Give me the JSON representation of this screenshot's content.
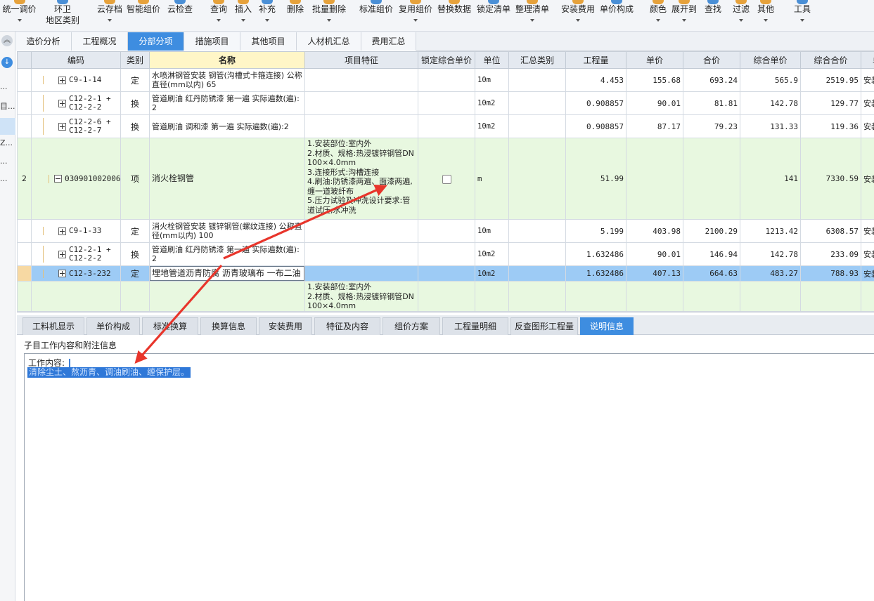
{
  "toolbar": {
    "buttons": [
      {
        "label": "统一调价",
        "dropdown": true
      },
      {
        "label": "环卫",
        "label2": "地区类别",
        "dropdown": false
      },
      {
        "label": "云存档",
        "dropdown": true
      },
      {
        "label": "智能组价",
        "dropdown": false
      },
      {
        "label": "云检查",
        "dropdown": false
      },
      {
        "label": "查询",
        "dropdown": true
      },
      {
        "label": "插入",
        "dropdown": true
      },
      {
        "label": "补充",
        "dropdown": true
      },
      {
        "label": "删除",
        "dropdown": false
      },
      {
        "label": "批量删除",
        "dropdown": true
      },
      {
        "label": "标准组价",
        "dropdown": false
      },
      {
        "label": "复用组价",
        "dropdown": true
      },
      {
        "label": "替换数据",
        "dropdown": false
      },
      {
        "label": "锁定清单",
        "dropdown": false
      },
      {
        "label": "整理清单",
        "dropdown": true
      },
      {
        "label": "安装费用",
        "dropdown": true
      },
      {
        "label": "单价构成",
        "dropdown": false
      },
      {
        "label": "颜色",
        "dropdown": true
      },
      {
        "label": "展开到",
        "dropdown": true
      },
      {
        "label": "查找",
        "dropdown": false
      },
      {
        "label": "过滤",
        "dropdown": true
      },
      {
        "label": "其他",
        "dropdown": true
      },
      {
        "label": "工具",
        "dropdown": true
      }
    ]
  },
  "left_strip": {
    "fragments": [
      "...",
      "目...",
      "Z...",
      "...",
      "..."
    ]
  },
  "tabs": [
    {
      "label": "造价分析",
      "active": false
    },
    {
      "label": "工程概况",
      "active": false
    },
    {
      "label": "分部分项",
      "active": true
    },
    {
      "label": "措施项目",
      "active": false
    },
    {
      "label": "其他项目",
      "active": false
    },
    {
      "label": "人材机汇总",
      "active": false
    },
    {
      "label": "费用汇总",
      "active": false
    }
  ],
  "grid": {
    "columns": [
      "",
      "编码",
      "类别",
      "名称",
      "项目特征",
      "锁定综合单价",
      "单位",
      "汇总类别",
      "工程量",
      "单价",
      "合价",
      "综合单价",
      "综合合价",
      "单"
    ],
    "rows": [
      {
        "kind": "item",
        "index": "",
        "code": "C9-1-14",
        "type": "定",
        "name": "水喷淋钢管安装 钢管(沟槽式卡箍连接) 公称直径(mm以内) 65",
        "feature": "",
        "lock": false,
        "unit": "10m",
        "category": "",
        "quantity": "4.453",
        "price": "155.68",
        "total": "693.24",
        "comp_price": "565.9",
        "comp_total": "2519.95",
        "extra": "安装"
      },
      {
        "kind": "item",
        "index": "",
        "code": "C12-2-1 +\nC12-2-2",
        "type": "换",
        "name": "管道刷油 红丹防锈漆 第一遍  实际遍数(遍):2",
        "feature": "",
        "lock": false,
        "unit": "10m2",
        "category": "",
        "quantity": "0.908857",
        "price": "90.01",
        "total": "81.81",
        "comp_price": "142.78",
        "comp_total": "129.77",
        "extra": "安装"
      },
      {
        "kind": "item",
        "index": "",
        "code": "C12-2-6 +\nC12-2-7",
        "type": "换",
        "name": "管道刷油 调和漆 第一遍  实际遍数(遍):2",
        "feature": "",
        "lock": false,
        "unit": "10m2",
        "category": "",
        "quantity": "0.908857",
        "price": "87.17",
        "total": "79.23",
        "comp_price": "131.33",
        "comp_total": "119.36",
        "extra": "安装"
      },
      {
        "kind": "head",
        "index": "2",
        "code": "030901002006",
        "type": "项",
        "name": "消火栓钢管",
        "feature": "1.安装部位:室内外\n2.材质、规格:热浸镀锌钢管DN100×4.0mm\n3.连接形式:沟槽连接\n4.刷油:防锈漆两遍、面漆两遍,缠一道玻纤布\n5.压力试验及冲洗设计要求:管道试压,水冲洗",
        "lock": false,
        "unit": "m",
        "category": "",
        "quantity": "51.99",
        "price": "",
        "total": "",
        "comp_price": "141",
        "comp_total": "7330.59",
        "extra": "安装"
      },
      {
        "kind": "item",
        "index": "",
        "code": "C9-1-33",
        "type": "定",
        "name": "消火栓钢管安装 镀锌钢管(螺纹连接) 公称直径(mm以内) 100",
        "feature": "",
        "lock": false,
        "unit": "10m",
        "category": "",
        "quantity": "5.199",
        "price": "403.98",
        "total": "2100.29",
        "comp_price": "1213.42",
        "comp_total": "6308.57",
        "extra": "安装"
      },
      {
        "kind": "item",
        "index": "",
        "code": "C12-2-1 +\nC12-2-2",
        "type": "换",
        "name": "管道刷油 红丹防锈漆 第一遍  实际遍数(遍):2",
        "feature": "",
        "lock": false,
        "unit": "10m2",
        "category": "",
        "quantity": "1.632486",
        "price": "90.01",
        "total": "146.94",
        "comp_price": "142.78",
        "comp_total": "233.09",
        "extra": "安装"
      },
      {
        "kind": "selected",
        "index": "",
        "code": "C12-3-232",
        "type": "定",
        "name": "埋地管道沥青防腐 沥青玻璃布 一布二油",
        "feature": "",
        "lock": false,
        "unit": "10m2",
        "category": "",
        "quantity": "1.632486",
        "price": "407.13",
        "total": "664.63",
        "comp_price": "483.27",
        "comp_total": "788.93",
        "extra": "安装"
      },
      {
        "kind": "head",
        "index": "",
        "code": "",
        "type": "",
        "name": "",
        "feature": "1.安装部位:室内外\n2.材质、规格:热浸镀锌钢管DN100×4.0mm",
        "lock": null,
        "unit": "",
        "category": "",
        "quantity": "",
        "price": "",
        "total": "",
        "comp_price": "",
        "comp_total": "",
        "extra": ""
      }
    ]
  },
  "bottom_tabs": [
    {
      "label": "工料机显示",
      "active": false
    },
    {
      "label": "单价构成",
      "active": false
    },
    {
      "label": "标准换算",
      "active": false
    },
    {
      "label": "换算信息",
      "active": false
    },
    {
      "label": "安装费用",
      "active": false
    },
    {
      "label": "特征及内容",
      "active": false
    },
    {
      "label": "组价方案",
      "active": false
    },
    {
      "label": "工程量明细",
      "active": false
    },
    {
      "label": "反查图形工程量",
      "active": false
    },
    {
      "label": "说明信息",
      "active": true
    }
  ],
  "detail": {
    "title": "子目工作内容和附注信息",
    "line1": "工作内容:",
    "line2": "清除尘土、熬沥青、调油刷油、缠保护层。"
  },
  "colors": {
    "accent": "#3e8de0",
    "head_row": "#e8f8e0",
    "selected_row": "#9dcbf5",
    "annotation_arrow": "#e8352b"
  }
}
